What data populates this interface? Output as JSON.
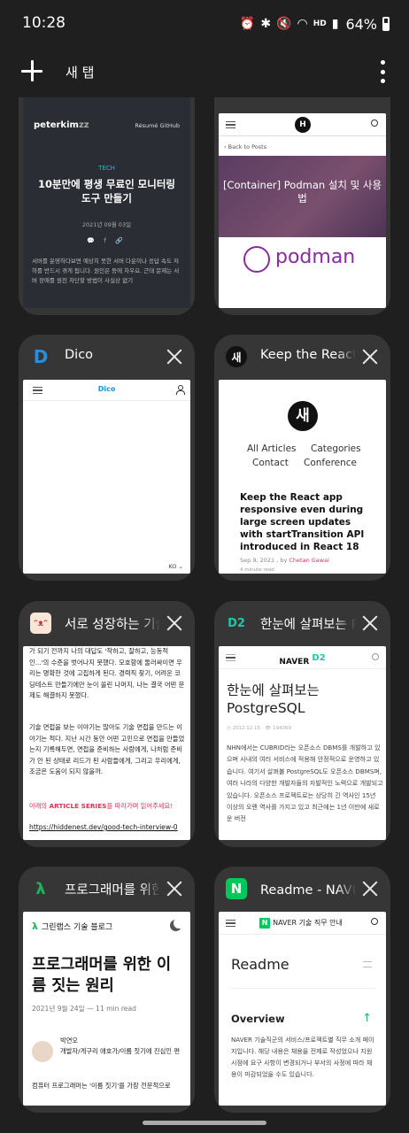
{
  "status_bar": {
    "time": "10:28",
    "battery_percent": "64%",
    "network_label": "HD"
  },
  "top_bar": {
    "new_tab_label": "새 탭"
  },
  "tabs": [
    {
      "title": "",
      "preview": {
        "logo": "peterkim",
        "logo_suffix": "zz",
        "nav": "Résumé   GitHub",
        "tag": "TECH",
        "headline": "10분만에 평생 무료인 모니터링 도구 만들기",
        "date": "2021년 09월 03일",
        "body": "서버를 운영하다보면 예상치 못한 서버 다운이나 응답 속도 저하를 반드시 겪게 됩니다. 원인은 등에 차우요. 근데 문제는 서버 장애를 원천 차단할 방법이 사실상 없기"
      }
    },
    {
      "title": "",
      "preview": {
        "site_logo": "H",
        "back_link": "Back to Posts",
        "hero_title": "[Container] Podman 설치 및 사용법",
        "brand": "podman"
      }
    },
    {
      "title": "Dico",
      "favicon": "D",
      "preview": {
        "logo": "Dico",
        "lang": "KO"
      }
    },
    {
      "title": "Keep the React app responsive",
      "favicon": "새",
      "preview": {
        "logo": "새",
        "nav": [
          "All Articles",
          "Categories",
          "Contact",
          "Conference"
        ],
        "headline": "Keep the React app responsive even during large screen updates with startTransition API introduced in React 18",
        "date": "Sep 9, 2021 , by ",
        "author": "Chetan Gawai",
        "read_time": "4 minute read"
      }
    },
    {
      "title": "서로 성장하는 기술 면접",
      "favicon": "",
      "preview": {
        "para1": "가 되기 전까지 나의 대답도 '착하고, 잘하고, 능동적인...'의 수준을 벗어나지 못했다. 모호함에 둘러싸이면 우리는 명확한 것에 고집하게 된다. 경력직 찾기, 어려운 코딩테스트 만들기에만 눈이 쏠린 나머지, 나는 결국 어떤 문제도 해결하지 못했다.",
        "para2": "기술 면접을 보는 이야기는 많아도 기술 면접을 만드는 이야기는 적다. 지난 시간 동안 어떤 고민으로 면접을 만들었는지 기록해두면, 면접을 준비하는 사람에게, 나처럼 준비가 안 된 상태로 리드가 된 사람들에게, 그리고 우리에게, 조금은 도움이 되지 않을까.",
        "series_prefix": "아래의 ",
        "series_bold": "ARTICLE SERIES",
        "series_suffix": "를 따라가며 읽어주세요!",
        "link": "https://hiddenest.dev/good-tech-interview-0"
      }
    },
    {
      "title": "한눈에 살펴보는 PostgreSQL",
      "favicon": "D2",
      "preview": {
        "logo": "NAVER",
        "logo_suffix": "D2",
        "headline": "한눈에 살펴보는 PostgreSQL",
        "date": "2012.12.15",
        "views": "194369",
        "body": "NHN에서는 CUBRID라는 오픈소스 DBMS를 개발하고 있으며 사내의 여러 서비스에 적용해 안정적으로 운영하고 있습니다. 여기서 살펴볼 PostgreSQL도 오픈소스 DBMS며, 여러 나라의 다양한 개발자들의 자발적인 노력으로 개발되고 있습니다. 오픈소스 프로젝트로는 상당히 긴 역사인 15년 이상의 오랜 역사를 가지고 있고 최근에는 1년 이만에 새로운 버전"
      }
    },
    {
      "title": "프로그래머를 위한 이름 짓는 원리",
      "favicon": "λ",
      "preview": {
        "logo_mark": "λ",
        "logo_text": "그린랩스 기술 블로그",
        "headline": "프로그래머를 위한 이름 짓는 원리",
        "date": "2021년 9월 24일 — 11 min read",
        "author_name": "박연오",
        "author_bio": "개발자/게구리 애호가/이름 짓기에 진심인 편",
        "footer": "컴퓨터 프로그래머는 '이름 짓기'를 가장 전문적으로"
      }
    },
    {
      "title": "Readme - NAVER 기술 직무 안내",
      "favicon": "N",
      "preview": {
        "logo_mark": "N",
        "logo_text": "NAVER 기술 직무 안내",
        "headline": "Readme",
        "section": "Overview",
        "body": "NAVER 기술직군의 서비스/프로젝트별 직무 소개 페이지입니다. 해당 내용은 채용을 전제로 작성었으나 지원 시점에 요구 사항이 변경되거나 부서의 사정에 따라 채용이 마감되었을 수도 있습니다."
      }
    }
  ],
  "colors": {
    "background": "#1f1f1f",
    "card": "#363636",
    "dico_blue": "#2a8ddb",
    "naver_green": "#03c75a",
    "d2_teal": "#1fc7a4",
    "podman_purple": "#892ca0"
  }
}
